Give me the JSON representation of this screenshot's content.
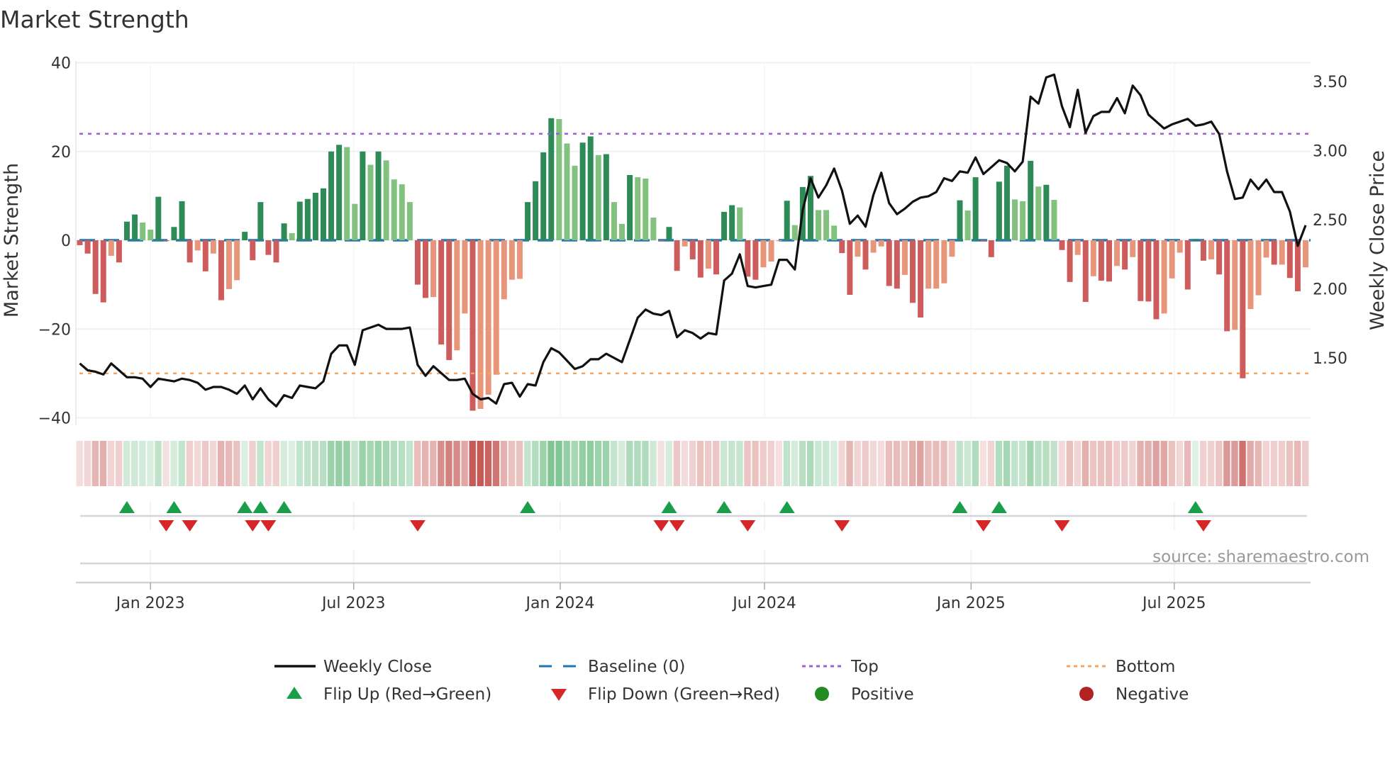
{
  "title": "Market Strength",
  "source": "source: sharemaestro.com",
  "chart_data": {
    "type": "bar",
    "title": "Market Strength",
    "ylabel": "Market Strength",
    "y2label": "Weekly Close Price",
    "ylim": [
      -40,
      40
    ],
    "y_ticks": [
      {
        "v": 40,
        "label": "40"
      },
      {
        "v": 20,
        "label": "20"
      },
      {
        "v": 0,
        "label": "0"
      },
      {
        "v": -20,
        "label": "−20"
      },
      {
        "v": -40,
        "label": "−40"
      }
    ],
    "y2_ticks": [
      {
        "v": 3.5,
        "label": "3.50"
      },
      {
        "v": 3.0,
        "label": "3.00"
      },
      {
        "v": 2.5,
        "label": "2.50"
      },
      {
        "v": 2.0,
        "label": "2.00"
      },
      {
        "v": 1.5,
        "label": "1.50"
      }
    ],
    "x_ticks": [
      {
        "date": "2023-01-01",
        "label": "Jan 2023"
      },
      {
        "date": "2023-07-01",
        "label": "Jul 2023"
      },
      {
        "date": "2024-01-01",
        "label": "Jan 2024"
      },
      {
        "date": "2024-07-01",
        "label": "Jul 2024"
      },
      {
        "date": "2025-01-01",
        "label": "Jan 2025"
      },
      {
        "date": "2025-07-01",
        "label": "Jul 2025"
      }
    ],
    "start_date": "2022-10-30",
    "interval_days": 7,
    "top": 24,
    "bottom": -30,
    "baseline": 0,
    "grid": true,
    "legend_placement": "bottom",
    "colors": {
      "pos_strong": "#2e8b57",
      "pos_weak": "#82c17e",
      "neg_strong": "#cd5c5c",
      "neg_weak": "#e8967a",
      "price": "#111111",
      "baseline": "#1f77b4",
      "top": "#9b5fd6",
      "bottom": "#f4a460",
      "flip_up": "#1a9e4a",
      "flip_down": "#d62728",
      "positive": "#228b22",
      "negative": "#b22222"
    },
    "strength": [
      -1.1,
      -3,
      -12.1,
      -14,
      -3.5,
      -5,
      4.2,
      5.8,
      4,
      2.4,
      9.8,
      -0.2,
      3,
      8.8,
      -5,
      -2.3,
      -7,
      -3,
      -13.5,
      -11,
      -9,
      1.9,
      -4.5,
      8.6,
      -3.3,
      -5,
      3.8,
      1.6,
      8.7,
      9.3,
      10.7,
      11.7,
      20,
      21.5,
      21,
      8.2,
      20,
      17,
      20,
      18,
      13.7,
      12.6,
      8.6,
      -10,
      -13,
      -12.8,
      -23.5,
      -27,
      -24.8,
      -16.5,
      -38.4,
      -38,
      -34.8,
      -30.3,
      -13.3,
      -8.9,
      -8.7,
      8.6,
      13.3,
      19.8,
      27.5,
      27.3,
      21.8,
      16.8,
      22,
      23.4,
      19.2,
      19.4,
      8.6,
      3.7,
      14.7,
      14.2,
      13.9,
      5.1,
      -0.2,
      3,
      -6.9,
      -1.4,
      -4.3,
      -8.4,
      -6.4,
      -7.7,
      6.4,
      7.9,
      7.4,
      -8.2,
      -8.9,
      -6.1,
      -4.8,
      -0.2,
      8.9,
      3.4,
      12,
      14.5,
      6.8,
      6.8,
      3.3,
      -2.9,
      -12.3,
      -3.7,
      -6.6,
      -2.8,
      -1.4,
      -10.3,
      -10.9,
      -7.8,
      -14.1,
      -17.4,
      -10.9,
      -10.9,
      -9.7,
      -3.7,
      9,
      6.7,
      14.2,
      -0.3,
      -3.8,
      13.2,
      16.8,
      9.2,
      8.8,
      17.9,
      12.1,
      12.5,
      9.1,
      -2.2,
      -9.4,
      -3.3,
      -13.9,
      -8.1,
      -9.1,
      -9.3,
      -5.8,
      -6.6,
      -3.8,
      -13.7,
      -13.8,
      -17.8,
      -16.5,
      -8.6,
      -2.8,
      -11.1,
      0.3,
      -4.6,
      -4.3,
      -7.7,
      -20.5,
      -20.2,
      -31.1,
      -15.5,
      -12.4,
      -3.9,
      -5.5,
      -5.5,
      -8.5,
      -11.5,
      -6.1
    ],
    "weekly_close": [
      1.46,
      1.41,
      1.4,
      1.38,
      1.46,
      1.41,
      1.36,
      1.36,
      1.35,
      1.29,
      1.35,
      1.34,
      1.33,
      1.35,
      1.34,
      1.32,
      1.27,
      1.29,
      1.29,
      1.27,
      1.24,
      1.3,
      1.2,
      1.28,
      1.2,
      1.15,
      1.23,
      1.21,
      1.3,
      1.29,
      1.28,
      1.33,
      1.53,
      1.59,
      1.59,
      1.45,
      1.7,
      1.72,
      1.74,
      1.71,
      1.71,
      1.71,
      1.72,
      1.45,
      1.37,
      1.44,
      1.39,
      1.34,
      1.34,
      1.35,
      1.24,
      1.2,
      1.21,
      1.17,
      1.31,
      1.32,
      1.22,
      1.31,
      1.3,
      1.47,
      1.57,
      1.54,
      1.48,
      1.42,
      1.44,
      1.49,
      1.49,
      1.53,
      1.5,
      1.47,
      1.63,
      1.79,
      1.85,
      1.82,
      1.81,
      1.84,
      1.65,
      1.7,
      1.68,
      1.64,
      1.68,
      1.67,
      2.06,
      2.11,
      2.25,
      2.02,
      2.01,
      2.02,
      2.03,
      2.21,
      2.21,
      2.14,
      2.57,
      2.8,
      2.66,
      2.75,
      2.87,
      2.71,
      2.47,
      2.53,
      2.45,
      2.68,
      2.84,
      2.62,
      2.54,
      2.58,
      2.63,
      2.66,
      2.67,
      2.7,
      2.8,
      2.78,
      2.85,
      2.84,
      2.95,
      2.83,
      2.88,
      2.93,
      2.91,
      2.85,
      2.92,
      3.39,
      3.34,
      3.53,
      3.55,
      3.32,
      3.17,
      3.44,
      3.13,
      3.25,
      3.28,
      3.28,
      3.38,
      3.27,
      3.47,
      3.4,
      3.26,
      3.21,
      3.16,
      3.19,
      3.21,
      3.23,
      3.18,
      3.19,
      3.21,
      3.12,
      2.85,
      2.65,
      2.66,
      2.79,
      2.72,
      2.79,
      2.7,
      2.7,
      2.56,
      2.31,
      2.46
    ],
    "flips_up": [
      6,
      12,
      21,
      23,
      26,
      57,
      75,
      82,
      90,
      112,
      117,
      142
    ],
    "flips_down": [
      11,
      14,
      22,
      24,
      43,
      74,
      76,
      85,
      97,
      115,
      125,
      143
    ],
    "legend": [
      {
        "key": "weekly_close",
        "label": "Weekly Close"
      },
      {
        "key": "baseline",
        "label": "Baseline (0)"
      },
      {
        "key": "top",
        "label": "Top"
      },
      {
        "key": "bottom",
        "label": "Bottom"
      },
      {
        "key": "flip_up",
        "label": "Flip Up (Red→Green)"
      },
      {
        "key": "flip_down",
        "label": "Flip Down (Green→Red)"
      },
      {
        "key": "positive",
        "label": "Positive"
      },
      {
        "key": "negative",
        "label": "Negative"
      }
    ]
  }
}
